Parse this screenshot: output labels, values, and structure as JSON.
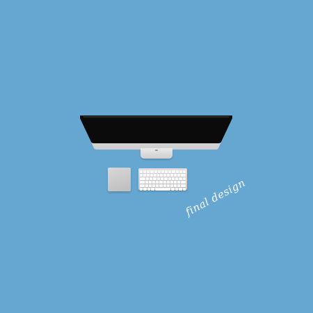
{
  "caption": "final design",
  "colors": {
    "background": "#66a7d2",
    "screen": "#0b0b0b",
    "aluminum": "#d6d6d6",
    "caption": "#ffffff"
  },
  "objects": [
    "monitor",
    "trackpad",
    "keyboard"
  ]
}
